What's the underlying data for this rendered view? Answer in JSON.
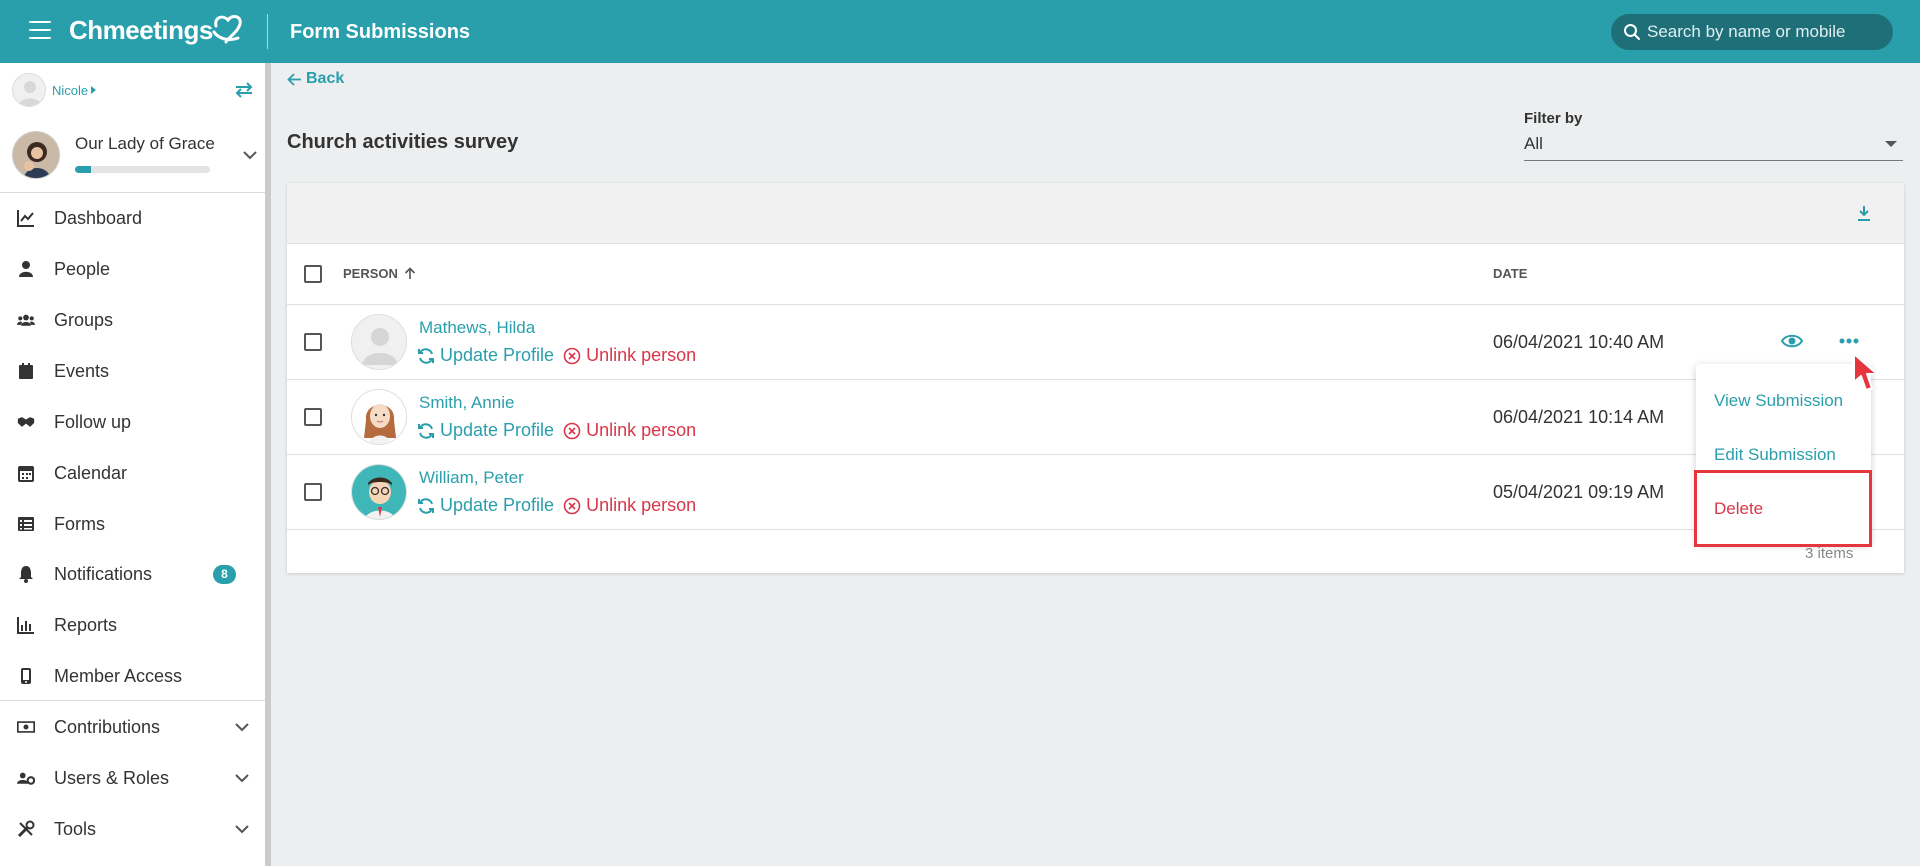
{
  "header": {
    "brand": "Chmeetings",
    "title": "Form Submissions",
    "search_placeholder": "Search by name or mobile"
  },
  "sidebar": {
    "user_name": "Nicole",
    "church_name": "Our Lady of Grace",
    "church_progress": 0.12,
    "items": [
      {
        "label": "Dashboard",
        "icon": "chart-line-icon"
      },
      {
        "label": "People",
        "icon": "person-icon"
      },
      {
        "label": "Groups",
        "icon": "users-icon"
      },
      {
        "label": "Events",
        "icon": "calendar-icon"
      },
      {
        "label": "Follow up",
        "icon": "handshake-icon"
      },
      {
        "label": "Calendar",
        "icon": "calendar-grid-icon"
      },
      {
        "label": "Forms",
        "icon": "list-icon"
      },
      {
        "label": "Notifications",
        "icon": "bell-icon",
        "badge": "8"
      },
      {
        "label": "Reports",
        "icon": "bar-chart-icon"
      },
      {
        "label": "Member Access",
        "icon": "mobile-icon"
      },
      {
        "label": "Contributions",
        "icon": "money-icon"
      },
      {
        "label": "Users & Roles",
        "icon": "users-cog-icon"
      },
      {
        "label": "Tools",
        "icon": "tools-icon"
      }
    ]
  },
  "main": {
    "back_label": "Back",
    "form_title": "Church activities survey",
    "filter": {
      "label": "Filter by",
      "value": "All"
    },
    "table": {
      "columns": {
        "person": "PERSON",
        "date": "DATE"
      },
      "rows": [
        {
          "name": "Mathews, Hilda",
          "date": "06/04/2021 10:40 AM",
          "avatar": "placeholder"
        },
        {
          "name": "Smith, Annie",
          "date": "06/04/2021 10:14 AM",
          "avatar": "female"
        },
        {
          "name": "William, Peter",
          "date": "05/04/2021 09:19 AM",
          "avatar": "male"
        }
      ],
      "update_label": "Update Profile",
      "unlink_label": "Unlink person",
      "items_count": "3 items"
    },
    "dropdown": {
      "view": "View Submission",
      "edit": "Edit Submission",
      "delete": "Delete"
    }
  },
  "colors": {
    "accent": "#2a9fac",
    "danger": "#d9364a",
    "highlight": "#e5353f"
  }
}
